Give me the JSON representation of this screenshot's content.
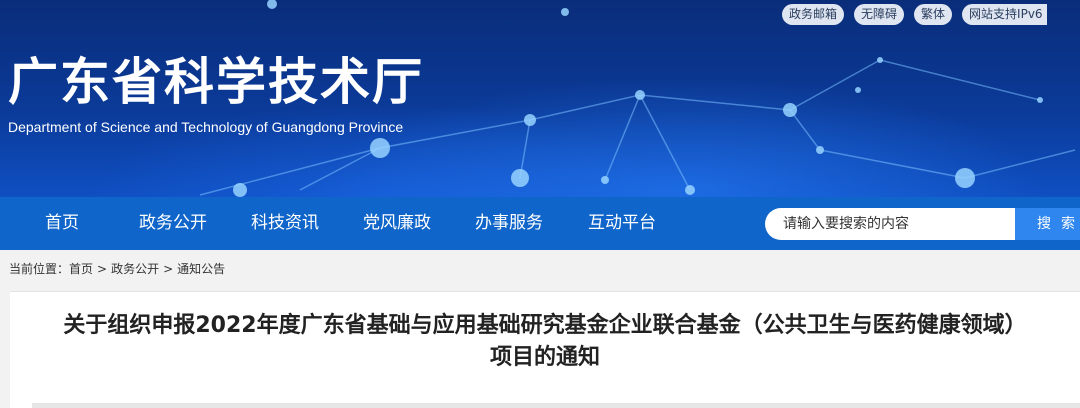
{
  "header": {
    "title": "广东省科学技术厅",
    "subtitle": "Department of Science and Technology of Guangdong Province",
    "top_links": [
      "政务邮箱",
      "无障碍",
      "繁体",
      "网站支持IPv6"
    ]
  },
  "nav": {
    "items": [
      "首页",
      "政务公开",
      "科技资讯",
      "党风廉政",
      "办事服务",
      "互动平台"
    ]
  },
  "search": {
    "placeholder": "请输入要搜索的内容",
    "button_label": "搜索"
  },
  "breadcrumb": {
    "prefix": "当前位置：",
    "items": [
      "首页",
      "政务公开",
      "通知公告"
    ],
    "separator": ">"
  },
  "article": {
    "title_line1": "关于组织申报2022年度广东省基础与应用基础研究基金企业联合基金（公共卫生与医药健康领域）",
    "title_line2": "项目的通知"
  },
  "colors": {
    "nav_bg": "#0f65c9",
    "banner_dark": "#0a2d7a",
    "search_button": "#2e86ee"
  }
}
